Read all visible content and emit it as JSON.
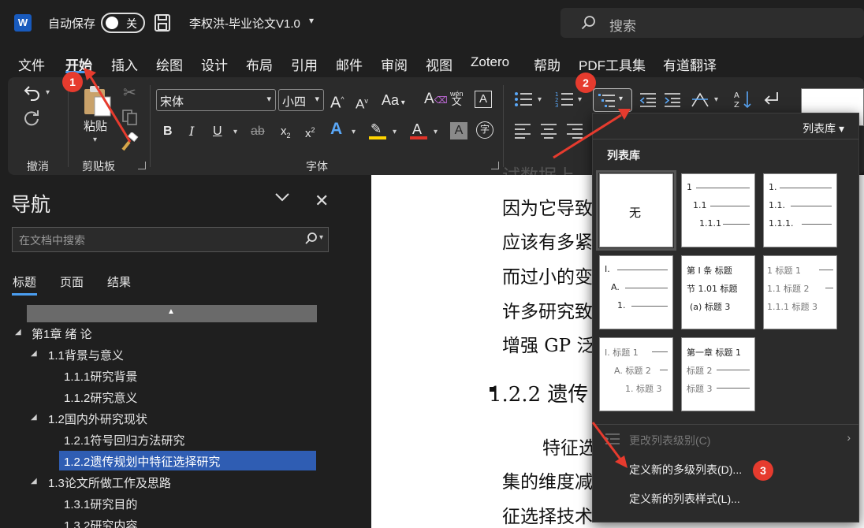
{
  "titlebar": {
    "app_logo": "W",
    "autosave_label": "自动保存",
    "autosave_state": "关",
    "doc_title": "李权洪-毕业论文V1.0",
    "search_placeholder": "搜索"
  },
  "menu": {
    "items": [
      "文件",
      "开始",
      "插入",
      "绘图",
      "设计",
      "布局",
      "引用",
      "邮件",
      "审阅",
      "视图",
      "Zotero",
      "帮助",
      "PDF工具集",
      "有道翻译"
    ],
    "active": "开始"
  },
  "ribbon": {
    "groups": {
      "undo": "撤消",
      "clipboard": "剪贴板",
      "font": "字体"
    },
    "paste_label": "粘贴",
    "font_name": "宋体",
    "font_size": "小四",
    "phonetic_top": "wén",
    "phonetic_bottom": "文",
    "case_label": "Aa",
    "grow_font": "A",
    "shrink_font": "A"
  },
  "annotations": {
    "badge1": "1",
    "badge2": "2",
    "badge3": "3"
  },
  "nav": {
    "title": "导航",
    "search_placeholder": "在文档中搜索",
    "tabs": [
      "标题",
      "页面",
      "结果"
    ],
    "active_tab": "标题",
    "tree": [
      {
        "label": "第1章 绪 论",
        "level": 1,
        "selected": false
      },
      {
        "label": "1.1背景与意义",
        "level": 2,
        "selected": false
      },
      {
        "label": "1.1.1研究背景",
        "level": 3,
        "selected": false
      },
      {
        "label": "1.1.2研究意义",
        "level": 3,
        "selected": false
      },
      {
        "label": "1.2国内外研究现状",
        "level": 2,
        "selected": false
      },
      {
        "label": "1.2.1符号回归方法研究",
        "level": 3,
        "selected": false
      },
      {
        "label": "1.2.2遗传规划中特征选择研究",
        "level": 3,
        "selected": true
      },
      {
        "label": "1.3论文所做工作及思路",
        "level": 2,
        "selected": false
      },
      {
        "label": "1.3.1研究目的",
        "level": 3,
        "selected": false
      },
      {
        "label": "1.3.2研究内容",
        "level": 3,
        "selected": false
      }
    ]
  },
  "document": {
    "lines": [
      "因为它导致",
      "应该有多紧",
      "而过小的变",
      "许多研究致",
      "增强 GP 泛"
    ],
    "heading": "1.2.2 遗传",
    "para_lines": [
      "特征选",
      "集的维度减",
      "征选择技术"
    ]
  },
  "dropdown": {
    "filter_label": "列表库",
    "section_heading": "列表库",
    "none_label": "无",
    "thumbs": [
      {
        "lines": [
          "1",
          "1.1",
          "1.1.1"
        ]
      },
      {
        "lines": [
          "1.",
          "1.1.",
          "1.1.1."
        ]
      },
      {
        "lines": [
          "I.",
          "A.",
          "1."
        ]
      },
      {
        "lines": [
          "第 I 条 标题",
          "节 1.01 标题",
          "(a) 标题 3"
        ]
      },
      {
        "lines": [
          "1 标题 1",
          "1.1 标题 2",
          "1.1.1 标题 3"
        ]
      },
      {
        "lines": [
          "I. 标题 1",
          "A. 标题 2",
          "1. 标题 3"
        ]
      },
      {
        "lines": [
          "第一章 标题 1",
          "标题 2",
          "标题 3"
        ]
      }
    ],
    "change_level": "更改列表级别(C)",
    "define_multilevel": "定义新的多级列表(D)...",
    "define_style": "定义新的列表样式(L)..."
  },
  "colors": {
    "accent_blue": "#4a9df0",
    "selection_blue": "#2f5db3",
    "annotation_red": "#e63b2e",
    "highlight_yellow": "#ffd400",
    "font_color_red": "#e0342a"
  }
}
